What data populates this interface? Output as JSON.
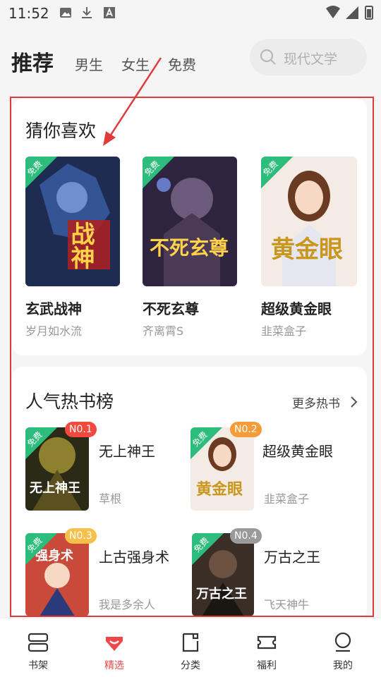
{
  "status": {
    "time": "11:52"
  },
  "header": {
    "tabs": [
      {
        "label": "推荐",
        "active": true
      },
      {
        "label": "男生",
        "active": false
      },
      {
        "label": "女生",
        "active": false
      },
      {
        "label": "免费",
        "active": false
      }
    ],
    "search_placeholder": "现代文学"
  },
  "guess": {
    "title": "猜你喜欢",
    "free_label": "免费",
    "books": [
      {
        "title": "玄武战神",
        "author": "岁月如水流",
        "cover_text": "战神",
        "cover_bg": "#1d2a4a"
      },
      {
        "title": "不死玄尊",
        "author": "齐离霄S",
        "cover_text": "不死玄尊",
        "cover_bg": "#3a2a4a"
      },
      {
        "title": "超级黄金眼",
        "author": "韭菜盒子",
        "cover_text": "黄金眼",
        "cover_bg": "#f3e7e0"
      }
    ]
  },
  "hot": {
    "title": "人气热书榜",
    "more": "更多热书",
    "free_label": "免费",
    "books": [
      {
        "rank": "N0.1",
        "title": "无上神王",
        "author": "草根",
        "cover_text": "无上神王",
        "badge_color": "#f4493c",
        "cover_bg": "#2a2a1a"
      },
      {
        "rank": "N0.2",
        "title": "超级黄金眼",
        "author": "韭菜盒子",
        "cover_text": "黄金眼",
        "badge_color": "#f59b38",
        "cover_bg": "#f3e7e0"
      },
      {
        "rank": "N0.3",
        "title": "上古强身术",
        "author": "我是多余人",
        "cover_text": "强身术",
        "badge_color": "#f7c04a",
        "cover_bg": "#c94a3a"
      },
      {
        "rank": "N0.4",
        "title": "万古之王",
        "author": "飞天神牛",
        "cover_text": "万古之王",
        "badge_color": "#9a9a9a",
        "cover_bg": "#3a2e26"
      }
    ]
  },
  "nav": [
    {
      "label": "书架",
      "active": false
    },
    {
      "label": "精选",
      "active": true
    },
    {
      "label": "分类",
      "active": false
    },
    {
      "label": "福利",
      "active": false
    },
    {
      "label": "我的",
      "active": false
    }
  ],
  "colors": {
    "accent": "#f2454a",
    "free_tag": "#2cbc7c",
    "annotation": "#e03a3a"
  }
}
